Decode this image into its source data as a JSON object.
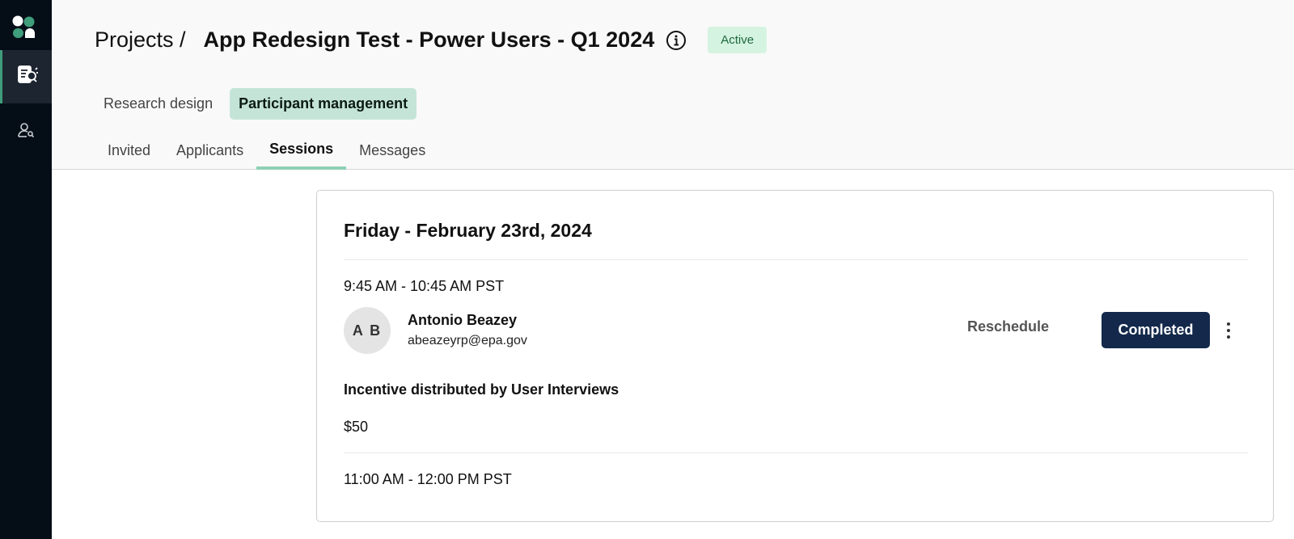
{
  "sidebar": {
    "logo": "app-logo",
    "items": [
      {
        "icon": "research-report-icon",
        "active": true
      },
      {
        "icon": "user-search-icon",
        "active": false
      }
    ]
  },
  "header": {
    "breadcrumb_root": "Projects /",
    "project_title": "App Redesign Test - Power Users - Q1 2024",
    "info_icon": "info-icon",
    "status": "Active"
  },
  "mode_tabs": [
    {
      "label": "Research design",
      "selected": false
    },
    {
      "label": "Participant management",
      "selected": true
    }
  ],
  "sub_tabs": [
    {
      "label": "Invited",
      "selected": false
    },
    {
      "label": "Applicants",
      "selected": false
    },
    {
      "label": "Sessions",
      "selected": true
    },
    {
      "label": "Messages",
      "selected": false
    }
  ],
  "session_day": {
    "date": "Friday - February 23rd, 2024",
    "sessions": [
      {
        "time": "9:45 AM - 10:45 AM PST",
        "participant": {
          "initials": "A B",
          "name": "Antonio Beazey",
          "email": "abeazeyrp@epa.gov"
        },
        "reschedule_label": "Reschedule",
        "status_label": "Completed",
        "more_icon": "more-vertical-icon",
        "incentive_label": "Incentive distributed by User Interviews",
        "incentive_amount": "$50"
      },
      {
        "time": "11:00 AM - 12:00 PM PST"
      }
    ]
  },
  "colors": {
    "sidebar_bg": "#050d17",
    "accent_green": "#3f9d7c",
    "tab_selected_bg": "#c5e4d8",
    "status_badge_bg": "#d5f3e1",
    "completed_button_bg": "#13284a"
  }
}
